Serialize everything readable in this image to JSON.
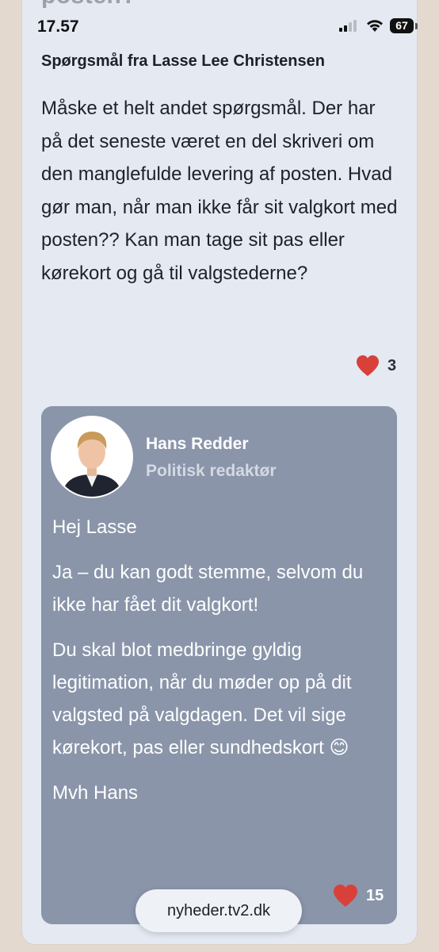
{
  "status_bar": {
    "time": "17.57",
    "battery": "67"
  },
  "header_cut_text": "posten?",
  "question": {
    "heading": "Spørgsmål fra Lasse Lee Christensen",
    "text": "Måske et helt andet spørgsmål. Der har på det seneste været en del skriveri om den manglefulde levering af posten. Hvad gør man, når man ikke får sit valgkort med posten?? Kan man tage sit pas eller kørekort og gå til valgstederne?",
    "likes": "3"
  },
  "answer": {
    "author_name": "Hans Redder",
    "author_role": "Politisk redaktør",
    "paragraphs": [
      "Hej Lasse",
      "Ja – du kan godt stemme, selvom du ikke har fået dit valgkort!",
      "Du skal blot medbringe gyldig legitimation, når du møder op på dit valgsted på valgdagen. Det vil sige kørekort, pas eller sundhedskort 😊",
      "Mvh Hans"
    ],
    "likes": "15"
  },
  "browser": {
    "url": "nyheder.tv2.dk"
  },
  "colors": {
    "heart": "#d9403a",
    "answer_bg": "#8a95aa",
    "card_bg": "#e4e9f2"
  },
  "icons": [
    "signal-icon",
    "wifi-icon",
    "battery-icon",
    "heart-icon",
    "avatar-photo"
  ]
}
